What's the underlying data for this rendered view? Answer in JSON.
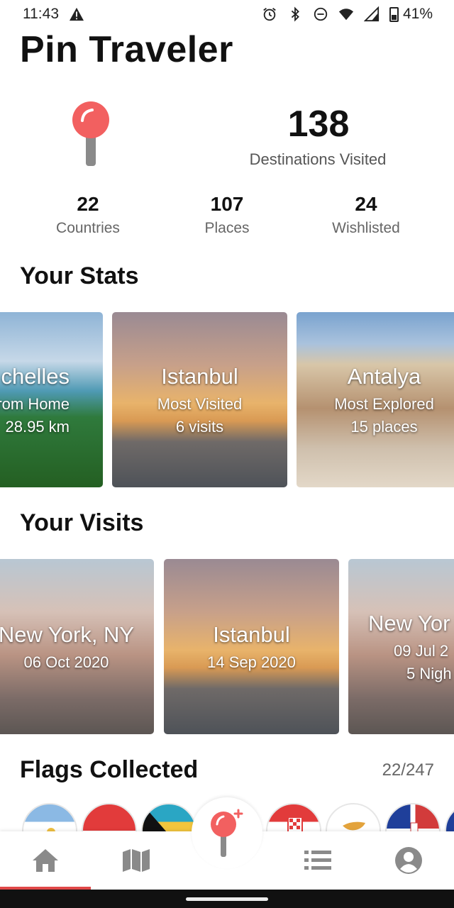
{
  "status_bar": {
    "time": "11:43",
    "battery": "41%"
  },
  "app": {
    "title": "Pin Traveler"
  },
  "summary": {
    "total": "138",
    "total_label": "Destinations Visited",
    "metrics": [
      {
        "value": "22",
        "label": "Countries"
      },
      {
        "value": "107",
        "label": "Places"
      },
      {
        "value": "24",
        "label": "Wishlisted"
      }
    ]
  },
  "stats": {
    "title": "Your Stats",
    "cards": [
      {
        "title": "chelles",
        "subtitle": "From Home",
        "detail": "28.95 km"
      },
      {
        "title": "Istanbul",
        "subtitle": "Most Visited",
        "detail": "6 visits"
      },
      {
        "title": "Antalya",
        "subtitle": "Most Explored",
        "detail": "15 places"
      }
    ]
  },
  "visits": {
    "title": "Your Visits",
    "cards": [
      {
        "title": "New York, NY",
        "date": "06 Oct 2020",
        "nights": ""
      },
      {
        "title": "Istanbul",
        "date": "14 Sep 2020",
        "nights": ""
      },
      {
        "title": "New Yor",
        "date": "09 Jul 2",
        "nights": "5 Nigh"
      }
    ]
  },
  "flags": {
    "title": "Flags Collected",
    "count": "22/247",
    "items": [
      "argentina",
      "indonesia",
      "bahamas",
      "croatia",
      "cyprus",
      "dominican-republic",
      "other"
    ]
  },
  "colors": {
    "accent": "#e04848",
    "pin": "#f26060",
    "nav_icon": "#8a8a8a"
  }
}
